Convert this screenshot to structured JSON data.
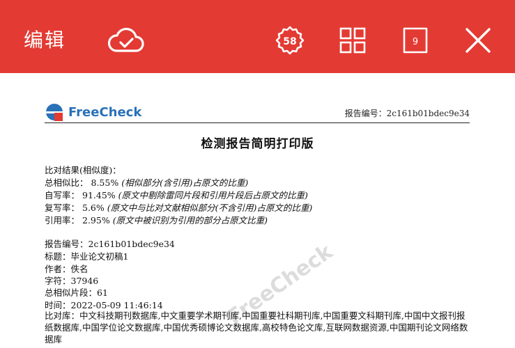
{
  "toolbar": {
    "title": "编辑",
    "badge_number": "58",
    "page_number": "9",
    "icons": [
      "cloud-check-icon",
      "badge-icon",
      "grid-icon",
      "page-icon",
      "close-icon"
    ]
  },
  "brand": {
    "logo_text": "FreeCheck",
    "logo_letter": "e",
    "colors": {
      "topbar": "#e33a33",
      "logo_blue": "#2a71b8",
      "logo_red": "#e33a33"
    }
  },
  "header": {
    "report_no": "报告编号：2c161b01bdec9e34"
  },
  "title": "检测报告简明打印版",
  "results": {
    "heading": "比对结果(相似度)：",
    "items": [
      {
        "label": "总相似比：",
        "value": "8.55%",
        "note": "(相似部分(含引用)占原文的比重)"
      },
      {
        "label": "自写率：",
        "value": "91.45%",
        "note": "(原文中剔除雷同片段和引用片段后占原文的比重)"
      },
      {
        "label": "复写率：",
        "value": "5.6%",
        "note": "(原文中与比对文献相似部分(不含引用)占原文的比重)"
      },
      {
        "label": "引用率：",
        "value": "2.95%",
        "note": "(原文中被识别为引用的部分占原文比重)"
      }
    ]
  },
  "info": {
    "report_no": "报告编号：2c161b01bdec9e34",
    "title": "标题：毕业论文初稿1",
    "author": "作者：佚名",
    "chars": "字符：37946",
    "similar_segments": "总相似片段：61",
    "time": "时间：2022-05-09 11:46:14",
    "compare_library": "比对库：中文科技期刊数据库,中文重要学术期刊库,中国重要社科期刊库,中国重要文科期刊库,中国中文报刊报纸数据库,中国学位论文数据库,中国优秀硕博论文数据库,高校特色论文库,互联网数据资源,中国期刊论文网络数据库"
  },
  "watermark": "FreeCheck"
}
